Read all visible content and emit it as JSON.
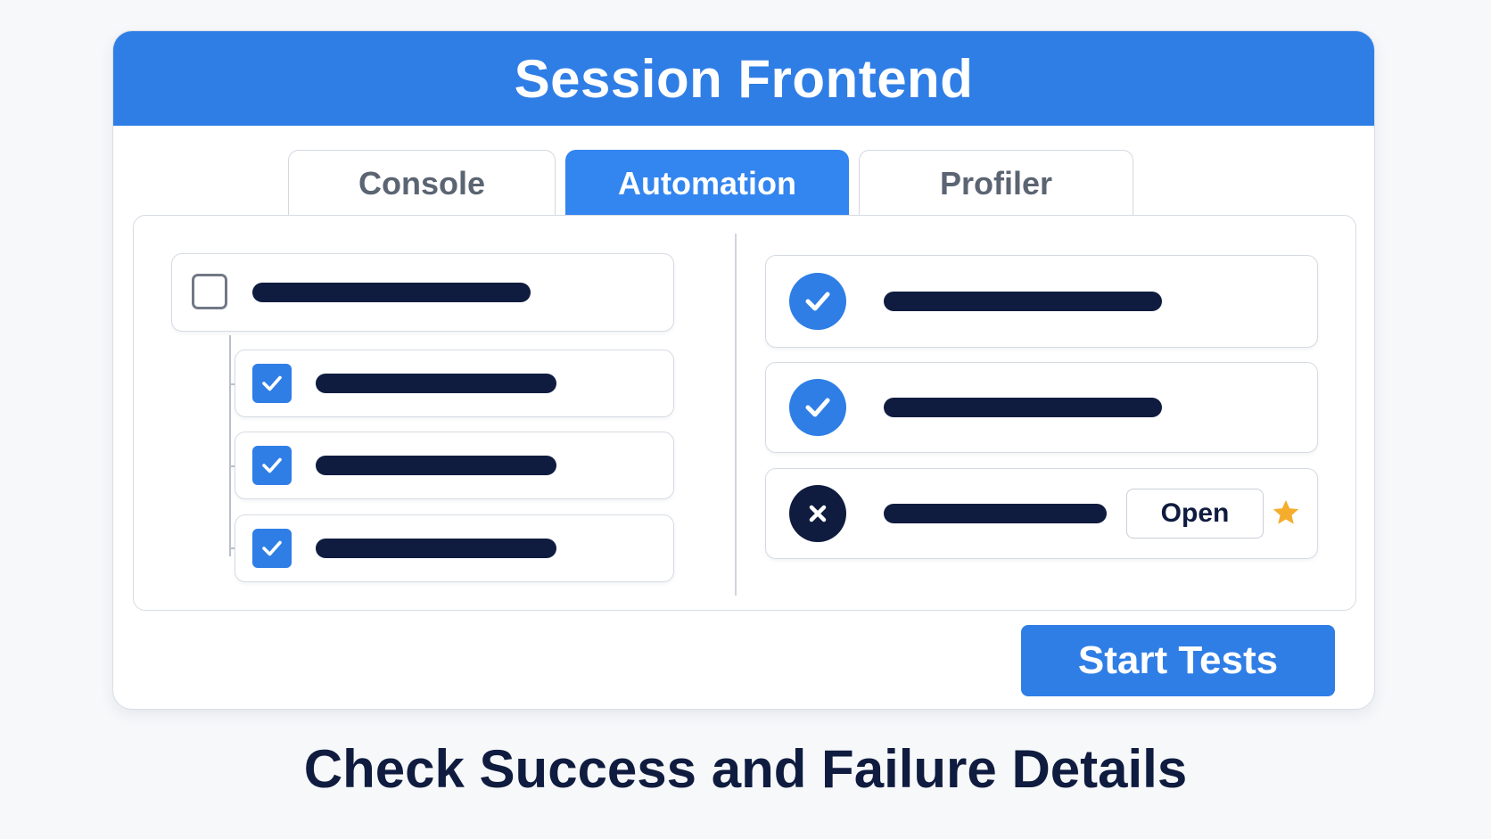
{
  "window": {
    "title": "Session Frontend"
  },
  "tabs": [
    {
      "label": "Console",
      "active": false
    },
    {
      "label": "Automation",
      "active": true
    },
    {
      "label": "Profiler",
      "active": false
    }
  ],
  "test_tree": {
    "parent": {
      "checked": false
    },
    "children": [
      {
        "checked": true
      },
      {
        "checked": true
      },
      {
        "checked": true
      }
    ]
  },
  "results": [
    {
      "status": "pass",
      "icon": "check-icon"
    },
    {
      "status": "pass",
      "icon": "check-icon"
    },
    {
      "status": "fail",
      "icon": "x-icon",
      "action_label": "Open",
      "starred": true
    }
  ],
  "actions": {
    "start_label": "Start Tests"
  },
  "caption": "Check Success and Failure Details",
  "colors": {
    "accent": "#2f7ee6",
    "dark": "#0f1c3f",
    "star": "#f5ad2e"
  }
}
